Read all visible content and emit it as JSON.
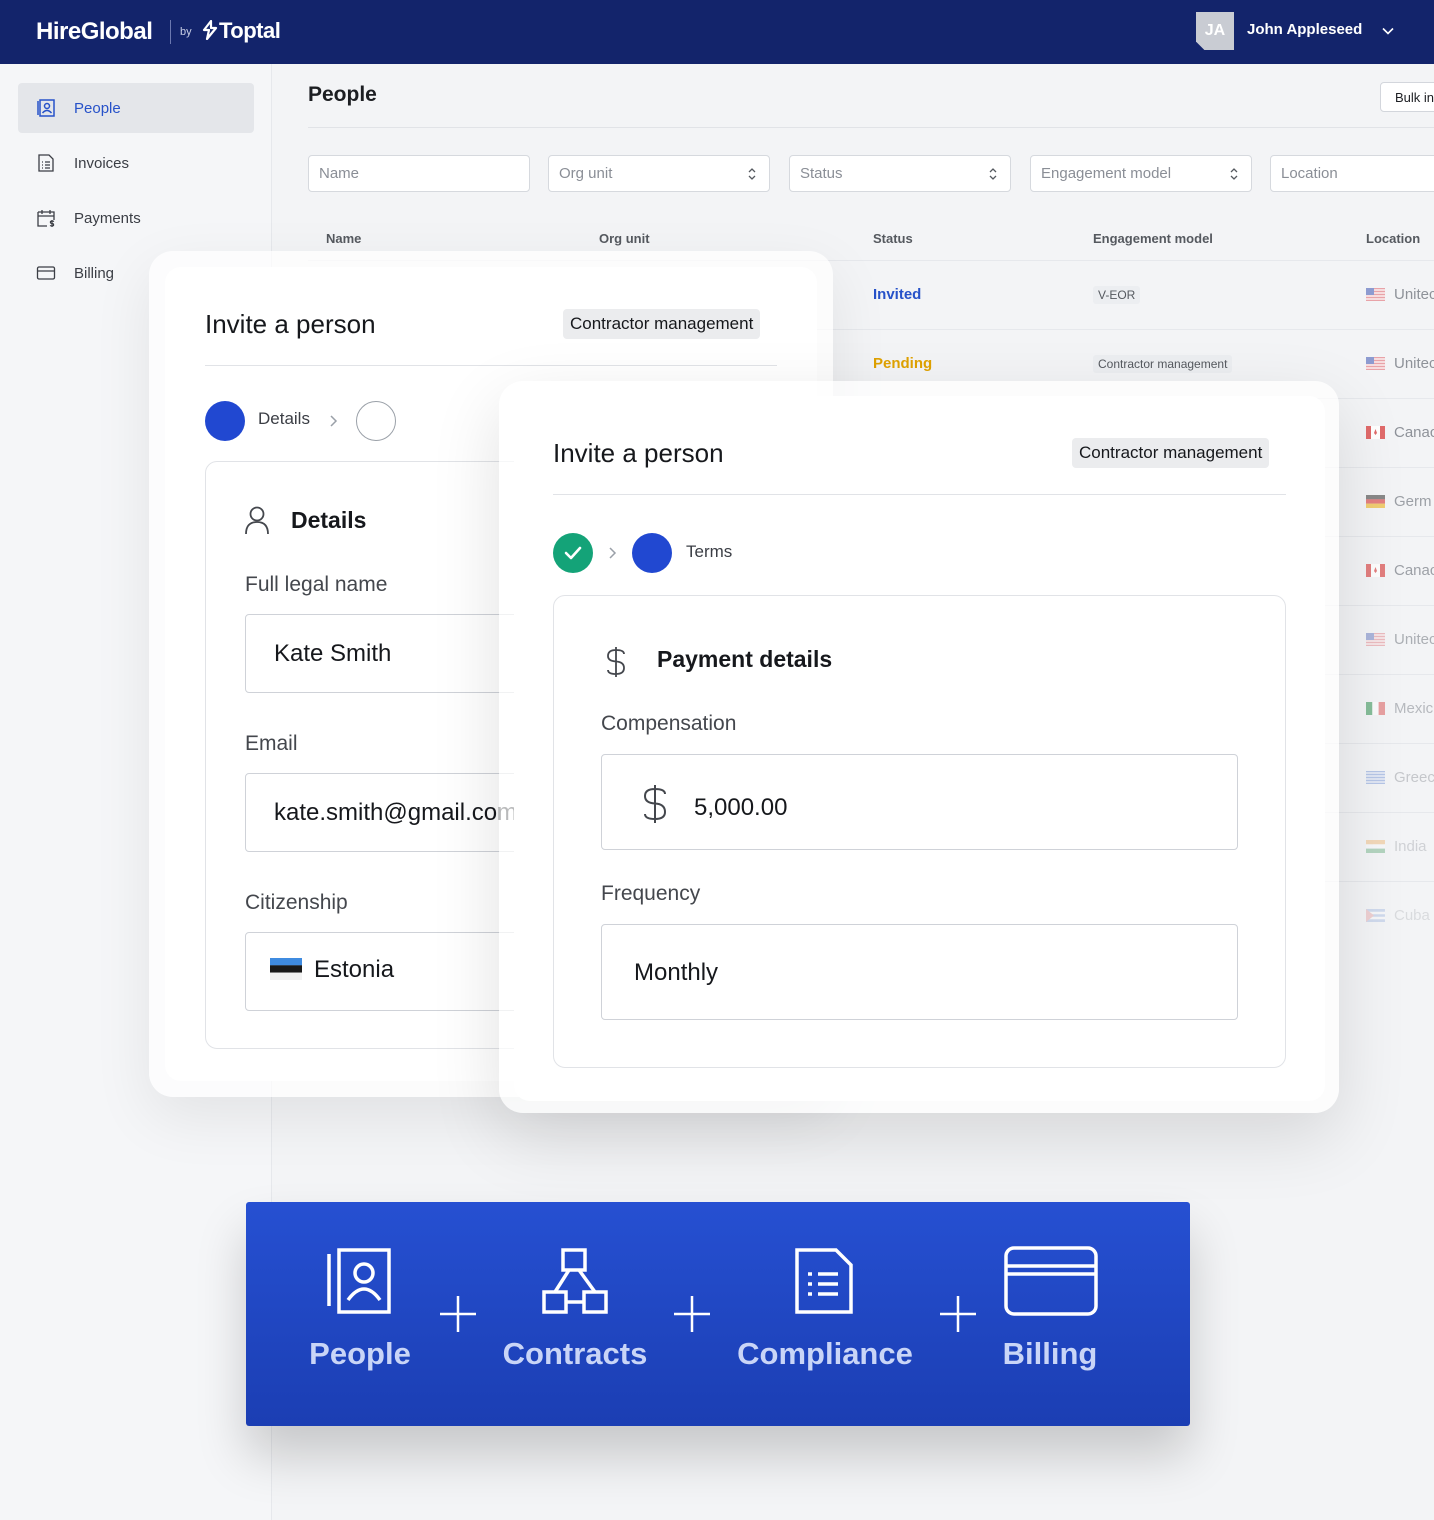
{
  "header": {
    "brand": "HireGlobal",
    "by": "by",
    "partner": "Toptal",
    "user_initials": "JA",
    "user_name": "John Appleseed"
  },
  "sidebar": {
    "items": [
      {
        "label": "People",
        "icon": "contact-card-icon",
        "active": true
      },
      {
        "label": "Invoices",
        "icon": "document-icon"
      },
      {
        "label": "Payments",
        "icon": "calendar-dollar-icon"
      },
      {
        "label": "Billing",
        "icon": "credit-card-icon"
      }
    ]
  },
  "main": {
    "title": "People",
    "bulk_button": "Bulk in",
    "filters": [
      {
        "placeholder": "Name"
      },
      {
        "placeholder": "Org unit"
      },
      {
        "placeholder": "Status"
      },
      {
        "placeholder": "Engagement model"
      },
      {
        "placeholder": "Location"
      }
    ],
    "columns": [
      "Name",
      "Org unit",
      "Status",
      "Engagement model",
      "Location"
    ],
    "rows": [
      {
        "status": "Invited",
        "engagement": "V-EOR",
        "location": "Unitec"
      },
      {
        "status": "Pending",
        "engagement": "Contractor management",
        "location": "Unitec"
      },
      {
        "location": "Canac"
      },
      {
        "location": "Germ"
      },
      {
        "location": "Canac"
      },
      {
        "location": "Unitec"
      },
      {
        "location": "Mexic"
      },
      {
        "location": "Greec"
      },
      {
        "location": "India"
      },
      {
        "location": "Cuba"
      }
    ],
    "colors": {
      "invited": "#2752c9",
      "pending": "#e0a200"
    }
  },
  "invite_details": {
    "title": "Invite a person",
    "badge": "Contractor management",
    "step_label": "Details",
    "section_title": "Details",
    "full_name_label": "Full legal name",
    "full_name_value": "Kate Smith",
    "email_label": "Email",
    "email_value": "kate.smith@gmail.com",
    "citizenship_label": "Citizenship",
    "citizenship_value": "Estonia"
  },
  "invite_terms": {
    "title": "Invite a person",
    "badge": "Contractor management",
    "step_label": "Terms",
    "section_title": "Payment details",
    "compensation_label": "Compensation",
    "compensation_value": "5,000.00",
    "frequency_label": "Frequency",
    "frequency_value": "Monthly",
    "colors": {
      "step_done": "#14a378",
      "step_active": "#2148d1"
    }
  },
  "banner": {
    "items": [
      {
        "label": "People",
        "icon": "contact-card-icon"
      },
      {
        "label": "Contracts",
        "icon": "org-chart-icon"
      },
      {
        "label": "Compliance",
        "icon": "document-icon"
      },
      {
        "label": "Billing",
        "icon": "credit-card-icon"
      }
    ],
    "separator": "+"
  }
}
